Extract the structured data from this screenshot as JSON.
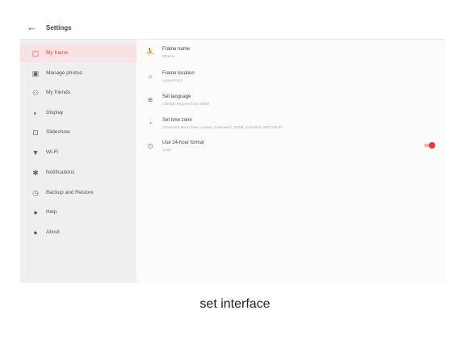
{
  "topbar": {
    "back_icon": "arrow-left-icon",
    "title": "Settings"
  },
  "sidebar": {
    "items": [
      {
        "label": "My frame",
        "icon": "frame-icon",
        "glyph": "▢",
        "active": true
      },
      {
        "label": "Manage photos",
        "icon": "photo-icon",
        "glyph": "▣",
        "active": false
      },
      {
        "label": "My friends",
        "icon": "people-icon",
        "glyph": "⚇",
        "active": false
      },
      {
        "label": "Display",
        "icon": "display-icon",
        "glyph": "◐",
        "active": false
      },
      {
        "label": "Slideshow",
        "icon": "slideshow-icon",
        "glyph": "⊡",
        "active": false
      },
      {
        "label": "Wi-Fi",
        "icon": "wifi-icon",
        "glyph": "▼",
        "active": false
      },
      {
        "label": "Notifications",
        "icon": "bell-icon",
        "glyph": "✱",
        "active": false
      },
      {
        "label": "Backup and Restore",
        "icon": "backup-icon",
        "glyph": "◷",
        "active": false
      },
      {
        "label": "Help",
        "icon": "help-icon",
        "glyph": "●",
        "active": false
      },
      {
        "label": "About",
        "icon": "info-icon",
        "glyph": "●",
        "active": false
      }
    ]
  },
  "settings": {
    "rows": [
      {
        "title": "Frame name",
        "subtitle": "Mframe",
        "icon": "person-icon",
        "glyph": "⛹",
        "toggle": false
      },
      {
        "title": "Frame location",
        "subtitle": "Living Room",
        "icon": "home-icon",
        "glyph": "⌂",
        "toggle": false
      },
      {
        "title": "Set language",
        "subtitle": "Lifestyle Engrand fmin 10000",
        "icon": "globe-icon",
        "glyph": "⊕",
        "toggle": false
      },
      {
        "title": "Set time zone",
        "subtitle": "Greenwich Mean Time, Lowest_Greenwich_ZONE_Convetion GMT+00:00",
        "icon": "clock-icon",
        "glyph": "◔",
        "toggle": false
      },
      {
        "title": "Use 24-hour format",
        "subtitle": "11:00",
        "icon": "time-icon",
        "glyph": "◷",
        "toggle": true,
        "toggle_on": true
      }
    ]
  },
  "caption": "set interface",
  "colors": {
    "accent": "#e8392e",
    "sidebar_bg": "#efefef",
    "active_bg": "#f7e3e3"
  }
}
